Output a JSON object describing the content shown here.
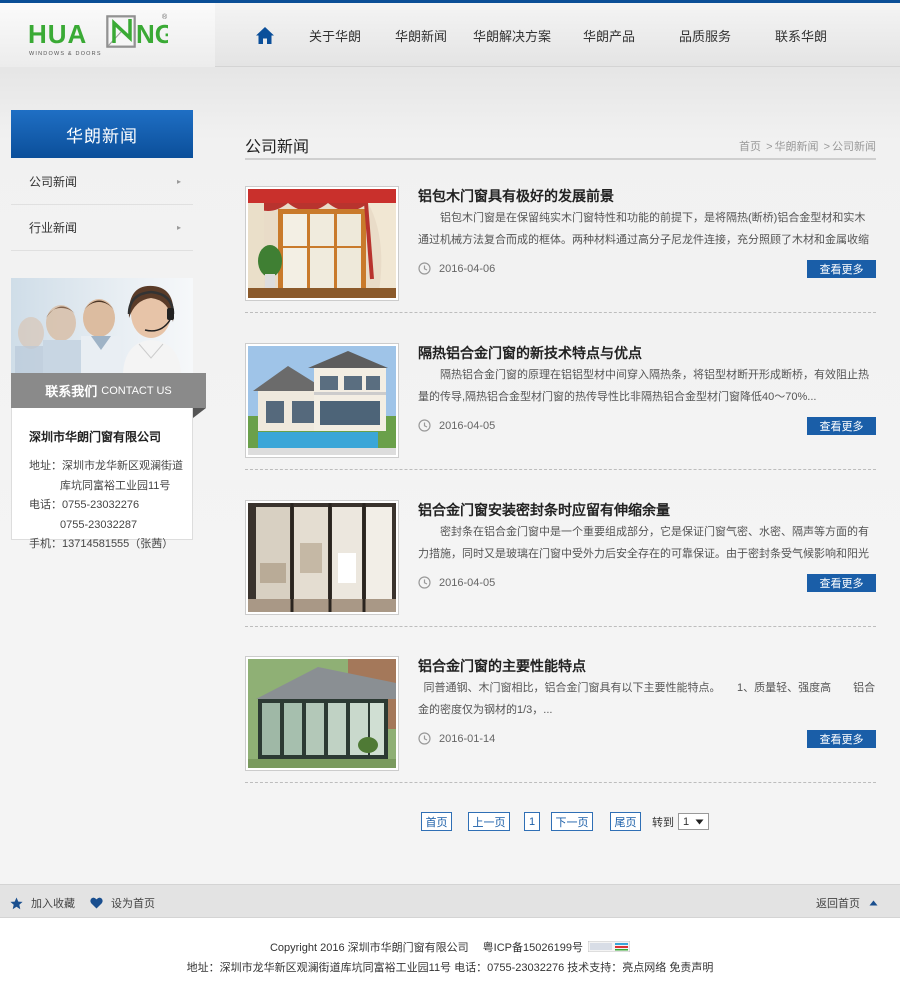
{
  "colors": {
    "brand": "#0b4f9a",
    "logo_green": "#3aaa35",
    "accent_button": "#1a5ea8"
  },
  "logo": {
    "text_left": "HUA",
    "text_right": "NG",
    "tagline": "WINDOWS & DOORS",
    "reg": "®"
  },
  "nav": {
    "home_icon": "home-icon",
    "items": [
      "关于华朗",
      "华朗新闻",
      "华朗解决方案",
      "华朗产品",
      "品质服务",
      "联系华朗"
    ]
  },
  "sidebar": {
    "title": "华朗新闻",
    "items": [
      {
        "label": "公司新闻",
        "arrow": "▸"
      },
      {
        "label": "行业新闻",
        "arrow": "▸"
      }
    ],
    "contact": {
      "title": "联系我们",
      "title_en": "CONTACT US",
      "company": "深圳市华朗门窗有限公司",
      "address_label": "地址：",
      "address_line1": "深圳市龙华新区观澜街道",
      "address_line2": "库坑同富裕工业园11号",
      "phone_label": "电话：",
      "phone1": "0755-23032276",
      "phone2": "0755-23032287",
      "mobile_label": "手机：",
      "mobile": "13714581555（张茜）"
    }
  },
  "main": {
    "title": "公司新闻",
    "breadcrumb": [
      "首页",
      "华朗新闻",
      "公司新闻"
    ],
    "breadcrumb_sep": ">",
    "articles": [
      {
        "title": "铝包木门窗具有极好的发展前景",
        "desc": "铝包木门窗是在保留纯实木门窗特性和功能的前提下，是将隔热(断桥)铝合金型材和实木通过机械方法复合而成的框体。两种材料通过高分子尼龙件连接，充分照顾了木材和金属收缩系数...",
        "date": "2016-04-06",
        "more": "查看更多"
      },
      {
        "title": "隔热铝合金门窗的新技术特点与优点",
        "desc": "隔热铝合金门窗的原理在铝铝型材中间穿入隔热条，将铝型材断开形成断桥，有效阻止热量的传导,隔热铝合金型材门窗的热传导性比非隔热铝合金型材门窗降低40～70%...",
        "date": "2016-04-05",
        "more": "查看更多"
      },
      {
        "title": "铝合金门窗安装密封条时应留有伸缩余量",
        "desc": "密封条在铝合金门窗中是一个重要组成部分，它是保证门窗气密、水密、隔声等方面的有力措施，同时又是玻璃在门窗中受外力后安全存在的可靠保证。由于密封条受气候影响和阳光照射，...",
        "date": "2016-04-05",
        "more": "查看更多"
      },
      {
        "title": "铝合金门窗的主要性能特点",
        "desc": "同普通钢、木门窗相比，铝合金门窗具有以下主要性能特点。　　1、质量轻、强度高　　铝合金的密度仅为钢材的1/3，...",
        "date": "2016-01-14",
        "more": "查看更多"
      }
    ]
  },
  "pagination": {
    "first": "首页",
    "prev": "上一页",
    "current": "1",
    "next": "下一页",
    "last": "尾页",
    "goto_label": "转到",
    "select_value": "1"
  },
  "footer": {
    "bookmark": "加入收藏",
    "set_home": "设为首页",
    "back_home": "返回首页",
    "copyright": "Copyright 2016 深圳市华朗门窗有限公司　 粤ICP备15026199号",
    "address_line": "地址：深圳市龙华新区观澜街道库坑同富裕工业园11号 电话：0755-23032276 技术支持：亮点网络 免责声明"
  }
}
